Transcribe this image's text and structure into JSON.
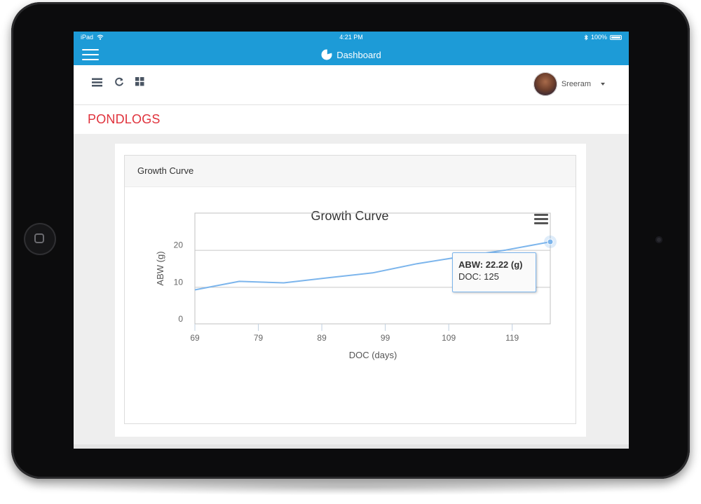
{
  "statusbar": {
    "carrier": "iPad",
    "time": "4:21 PM",
    "battery": "100%"
  },
  "navbar": {
    "title": "Dashboard",
    "menu_icon": "hamburger-icon",
    "title_icon": "pie-chart-icon"
  },
  "toolbar": {
    "icons": [
      "list-icon",
      "refresh-icon",
      "grid-icon"
    ],
    "user_name": "Sreeram"
  },
  "page": {
    "title": "PONDLOGS"
  },
  "panel": {
    "title": "Growth Curve"
  },
  "tooltip": {
    "line1": "ABW: 22.22 (g)",
    "line2": "DOC: 125"
  },
  "colors": {
    "accent": "#1d9bd7",
    "title_red": "#e0323c",
    "series": "#7cb5ec"
  },
  "chart_data": {
    "type": "line",
    "title": "Growth Curve",
    "xlabel": "DOC (days)",
    "ylabel": "ABW (g)",
    "xlim": [
      69,
      125
    ],
    "ylim": [
      0,
      30
    ],
    "xticks": [
      69,
      79,
      89,
      99,
      109,
      119
    ],
    "yticks": [
      0,
      10,
      20
    ],
    "grid": true,
    "legend": false,
    "series": [
      {
        "x": [
          69,
          76,
          83,
          90,
          97,
          104,
          111,
          118,
          125
        ],
        "y": [
          9.2,
          11.5,
          11.1,
          12.5,
          13.8,
          16.3,
          18.2,
          20.0,
          22.22
        ]
      }
    ]
  }
}
